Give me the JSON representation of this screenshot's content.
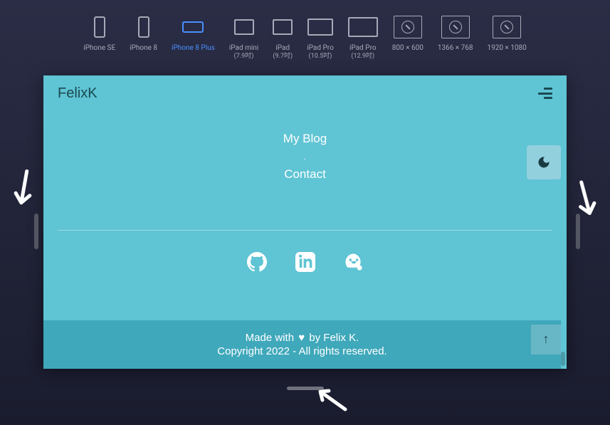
{
  "devices": [
    {
      "label": "iPhone SE",
      "sublabel": "",
      "type": "phone"
    },
    {
      "label": "iPhone 8",
      "sublabel": "",
      "type": "phone"
    },
    {
      "label": "iPhone 8 Plus",
      "sublabel": "",
      "type": "phone-landscape",
      "selected": true
    },
    {
      "label": "iPad mini",
      "sublabel": "(7.9吋)",
      "type": "tablet"
    },
    {
      "label": "iPad",
      "sublabel": "(9.7吋)",
      "type": "tablet"
    },
    {
      "label": "iPad Pro",
      "sublabel": "(10.5吋)",
      "type": "tablet-wide"
    },
    {
      "label": "iPad Pro",
      "sublabel": "(12.9吋)",
      "type": "tablet-wider"
    },
    {
      "label": "800 × 600",
      "sublabel": "",
      "type": "desktop"
    },
    {
      "label": "1366 × 768",
      "sublabel": "",
      "type": "desktop"
    },
    {
      "label": "1920 × 1080",
      "sublabel": "",
      "type": "desktop"
    }
  ],
  "page": {
    "logo": "FelixK",
    "nav": {
      "blog": "My Blog",
      "contact": "Contact"
    },
    "footer": {
      "line1_prefix": "Made with",
      "line1_suffix": "by Felix K.",
      "line2": "Copyright 2022 - All rights reserved."
    }
  },
  "icons": {
    "moon": "moon-icon",
    "arrow_up": "↑",
    "github": "github-icon",
    "linkedin": "linkedin-icon",
    "blog": "blog-icon"
  }
}
